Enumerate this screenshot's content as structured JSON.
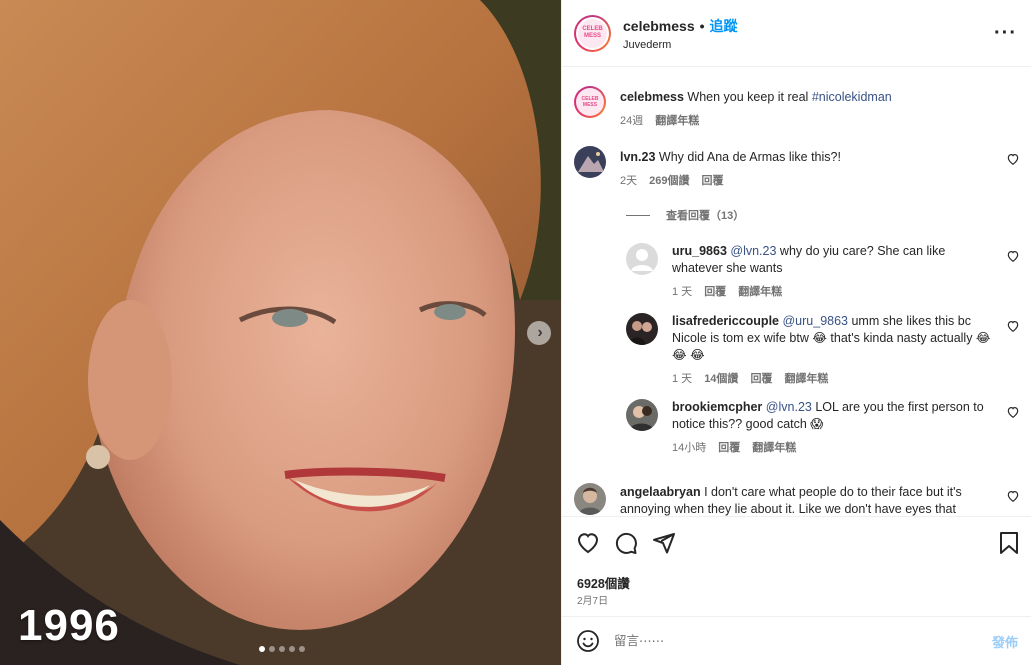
{
  "media": {
    "year_label": "1996",
    "slide_count": 5,
    "active_slide": 0
  },
  "header": {
    "username": "celebmess",
    "separator": "•",
    "follow_label": "追蹤",
    "location": "Juvederm",
    "avatar_text_1": "CELEB",
    "avatar_text_2": "MESS"
  },
  "caption": {
    "username": "celebmess",
    "text": "When you keep it real",
    "hashtag": "#nicolekidman",
    "time": "24週",
    "translate": "翻譯年糕"
  },
  "comments": [
    {
      "username": "lvn.23",
      "text": "Why did Ana de Armas like this?!",
      "time": "2天",
      "likes": "269個讚",
      "reply": "回覆"
    }
  ],
  "view_replies_label": "查看回覆（13）",
  "replies": [
    {
      "username": "uru_9863",
      "mention": "@lvn.23",
      "text": "why do yiu care? She can like whatever she wants",
      "time": "1 天",
      "reply": "回覆",
      "translate": "翻譯年糕"
    },
    {
      "username": "lisafredericcouple",
      "mention": "@uru_9863",
      "text": "umm she likes this bc Nicole is tom ex wife btw 😂 that's kinda nasty actually 😂 😂 😂",
      "time": "1 天",
      "likes": "14個讚",
      "reply": "回覆",
      "translate": "翻譯年糕"
    },
    {
      "username": "brookiemcpher",
      "mention": "@lvn.23",
      "text": "LOL are you the first person to notice this?? good catch 😱",
      "time": "14小時",
      "reply": "回覆",
      "translate": "翻譯年糕"
    }
  ],
  "last_comment": {
    "username": "angelaabryan",
    "text": "I don't care what people do to their face but it's annoying when they lie about it. Like we don't have eyes that"
  },
  "footer": {
    "likes": "6928個讚",
    "date": "2月7日",
    "comment_placeholder": "留言⋯⋯",
    "post_label": "發佈"
  },
  "colors": {
    "link_blue": "#0095f6",
    "mention_blue": "#385185",
    "post_disabled": "#9ccdf7"
  },
  "icons": [
    "more-options-icon",
    "heart-icon",
    "comment-icon",
    "share-icon",
    "save-icon",
    "emoji-icon",
    "chevron-right-icon"
  ]
}
